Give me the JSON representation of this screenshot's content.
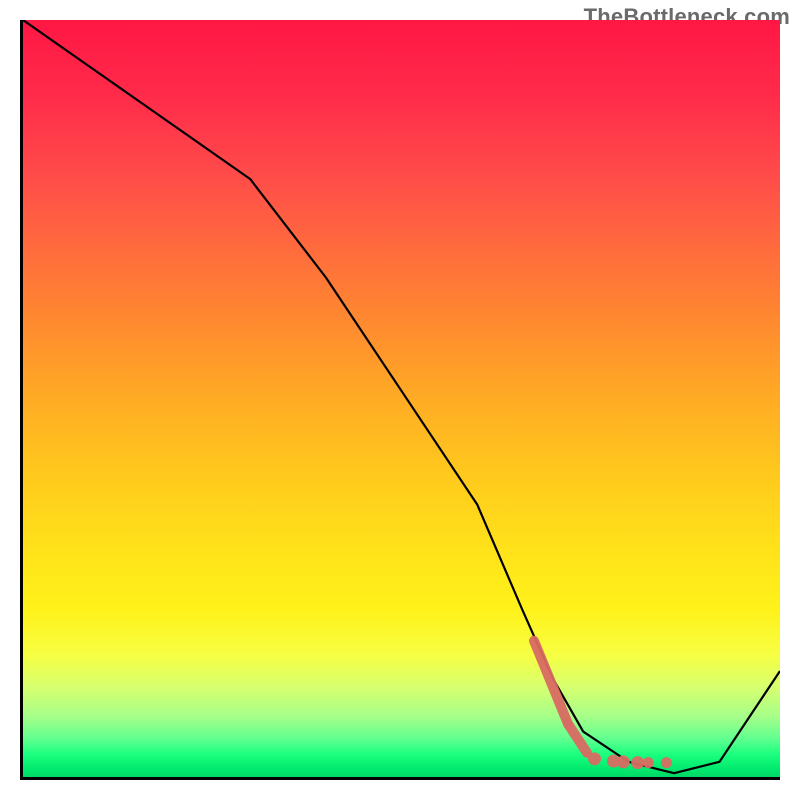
{
  "watermark": "TheBottleneck.com",
  "chart_data": {
    "type": "line",
    "title": "",
    "xlabel": "",
    "ylabel": "",
    "xlim": [
      0,
      100
    ],
    "ylim": [
      0,
      100
    ],
    "x": [
      0,
      10,
      20,
      30,
      40,
      50,
      60,
      66,
      70,
      74,
      80,
      86,
      92,
      100
    ],
    "values": [
      100,
      93,
      86,
      79,
      66,
      51,
      36,
      22,
      13,
      6,
      2,
      0.5,
      2,
      14
    ],
    "note": "Values approximate the black V-shaped curve; x and y are percent-of-axis. A salmon dot-dash overlay appears on the lower-left of the valley between roughly x=68 and x=86, y≈0–18.",
    "marker_overlay": {
      "color": "#d96b63",
      "dots": [
        {
          "x": 75.5,
          "y": 2.4
        },
        {
          "x": 78.0,
          "y": 2.1
        },
        {
          "x": 79.3,
          "y": 2.0
        },
        {
          "x": 81.2,
          "y": 1.9
        },
        {
          "x": 82.6,
          "y": 1.9
        },
        {
          "x": 85.0,
          "y": 1.9
        }
      ],
      "stroke_segments": [
        {
          "x1": 67.5,
          "y1": 18.0,
          "x2": 72.0,
          "y2": 7.0
        },
        {
          "x1": 72.0,
          "y1": 7.0,
          "x2": 74.5,
          "y2": 3.2
        }
      ]
    }
  }
}
